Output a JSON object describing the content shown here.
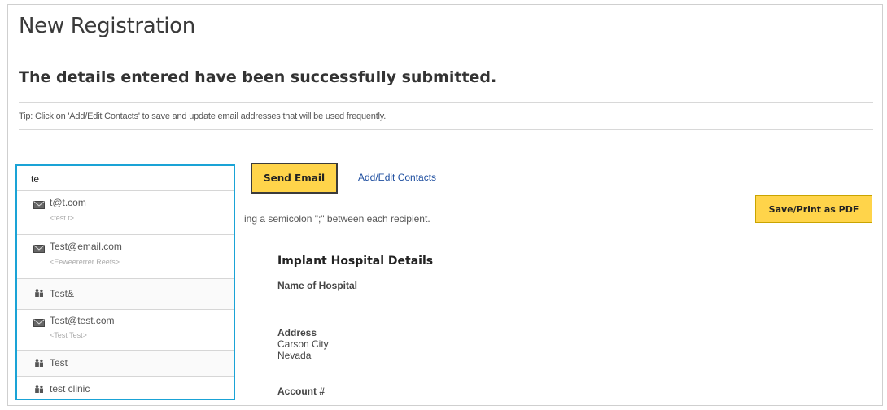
{
  "page": {
    "title": "New Registration",
    "success_message": "The details entered have been successfully submitted.",
    "tip": "Tip: Click on 'Add/Edit Contacts' to save and update email addresses that will be used frequently."
  },
  "email": {
    "input_value": "te",
    "send_label": "Send Email",
    "contacts_link": "Add/Edit Contacts",
    "recipient_hint": "ing a semicolon \";\" between each recipient."
  },
  "pdf_button": "Save/Print as PDF",
  "autocomplete": [
    {
      "type": "email",
      "icon": "envelope-icon",
      "label": "t@t.com",
      "sub": "<test t>"
    },
    {
      "type": "email",
      "icon": "envelope-icon",
      "label": "Test@email.com",
      "sub": "<Eeweererrer Reefs>"
    },
    {
      "type": "group",
      "icon": "group-icon",
      "label": "Test&",
      "sub": ""
    },
    {
      "type": "email",
      "icon": "envelope-icon",
      "label": "Test@test.com",
      "sub": "<Test Test>"
    },
    {
      "type": "group",
      "icon": "group-icon",
      "label": "Test",
      "sub": ""
    },
    {
      "type": "group",
      "icon": "group-icon",
      "label": "test clinic",
      "sub": ""
    }
  ],
  "details": {
    "heading": "Implant Hospital Details",
    "hospital_name_label": "Name of Hospital",
    "address_label": "Address",
    "address_line1": "Carson City",
    "address_line2": "Nevada",
    "account_label": "Account #"
  },
  "colors": {
    "accent_yellow": "#ffd44a",
    "autocomplete_border": "#1aa3d6",
    "link": "#1f4fa0"
  }
}
